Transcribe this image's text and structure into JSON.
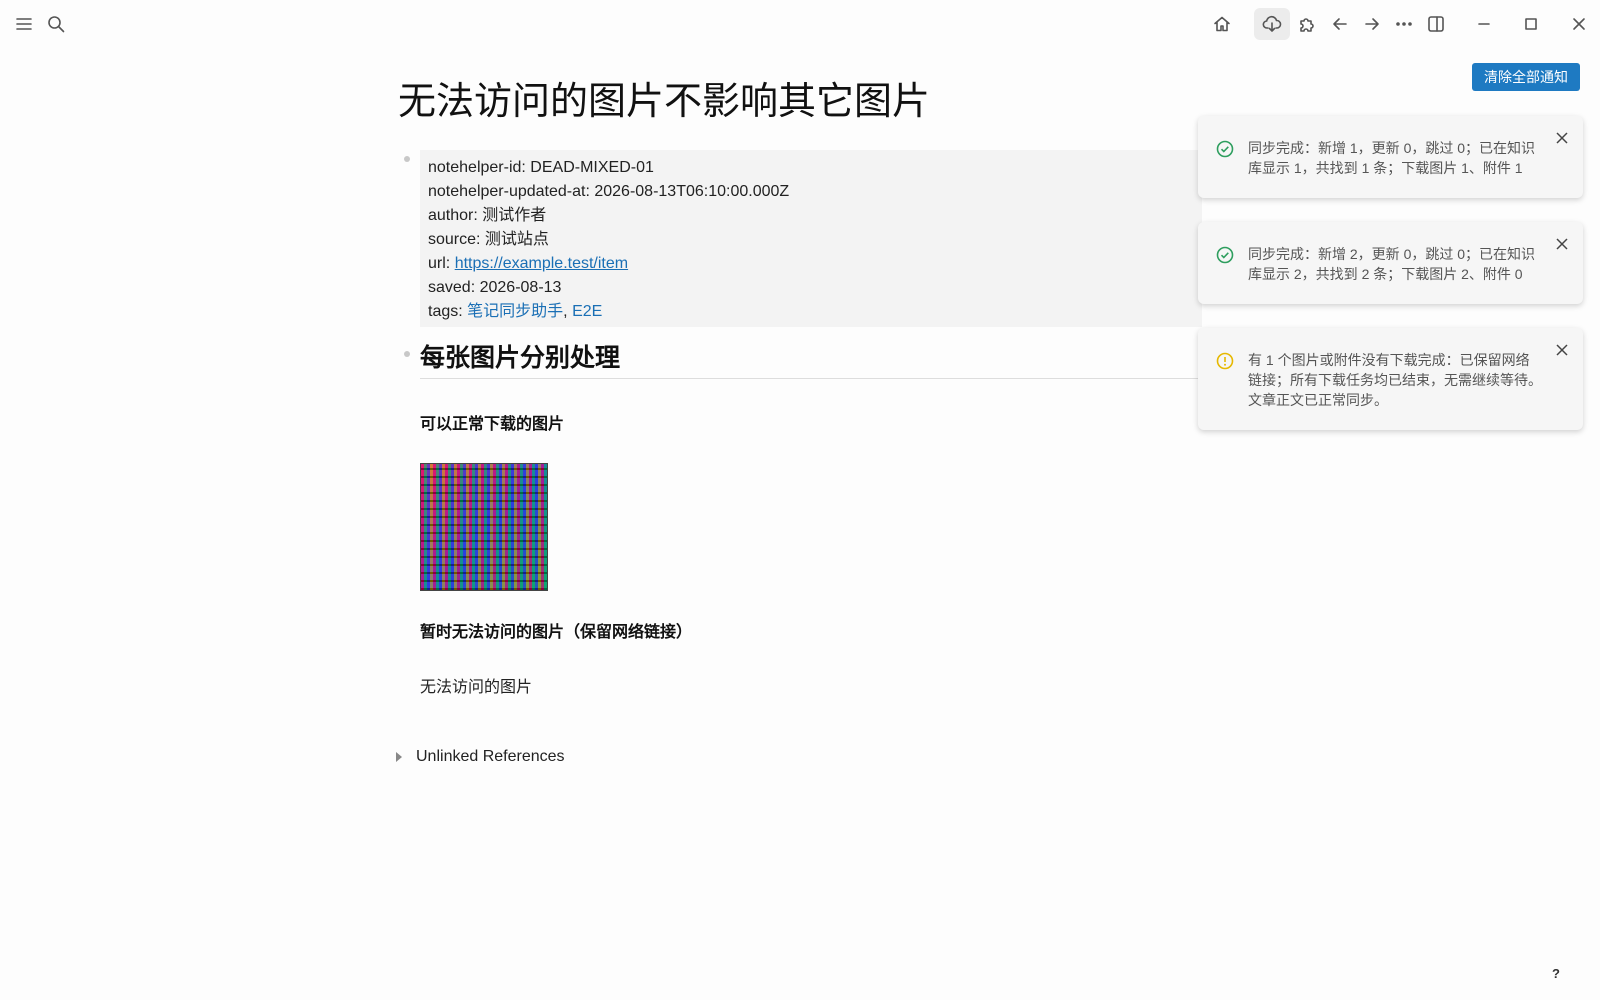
{
  "toolbar": {
    "left_icons": [
      "menu-icon",
      "search-icon"
    ],
    "right_icons": [
      "home-icon",
      "cloud-download-icon",
      "puzzle-icon",
      "back-arrow-icon",
      "forward-arrow-icon",
      "more-icon",
      "sidebar-toggle-icon",
      "minimize-icon",
      "maximize-icon",
      "close-icon"
    ]
  },
  "page": {
    "title": "无法访问的图片不影响其它图片",
    "properties": {
      "id_key": "notehelper-id:",
      "id_val": "DEAD-MIXED-01",
      "updated_key": "notehelper-updated-at:",
      "updated_val": "2026-08-13T06:10:00.000Z",
      "author_key": "author:",
      "author_val": "测试作者",
      "source_key": "source:",
      "source_val": "测试站点",
      "url_key": "url:",
      "url_val": "https://example.test/item",
      "saved_key": "saved:",
      "saved_val": "2026-08-13",
      "tags_key": "tags:",
      "tag1": "笔记同步助手",
      "tag_sep": ",",
      "tag2": "E2E"
    },
    "heading": "每张图片分别处理",
    "ok_label": "可以正常下载的图片",
    "broken_label": "暂时无法访问的图片（保留网络链接）",
    "broken_alt": "无法访问的图片",
    "unlinked": "Unlinked References"
  },
  "notifications": {
    "clear_all": "清除全部通知",
    "items": [
      {
        "type": "success",
        "text": "同步完成：新增 1，更新 0，跳过 0；已在知识库显示 1，共找到 1 条；下载图片 1、附件 1"
      },
      {
        "type": "success",
        "text": "同步完成：新增 2，更新 0，跳过 0；已在知识库显示 2，共找到 2 条；下载图片 2、附件 0"
      },
      {
        "type": "warning",
        "text": "有 1 个图片或附件没有下载完成：已保留网络链接；所有下载任务均已结束，无需继续等待。文章正文已正常同步。"
      }
    ]
  },
  "colors": {
    "accent": "#1e7ac2",
    "success": "#2e9e5e",
    "warning": "#e6b800",
    "link": "#1a6fb5"
  },
  "help": "?"
}
